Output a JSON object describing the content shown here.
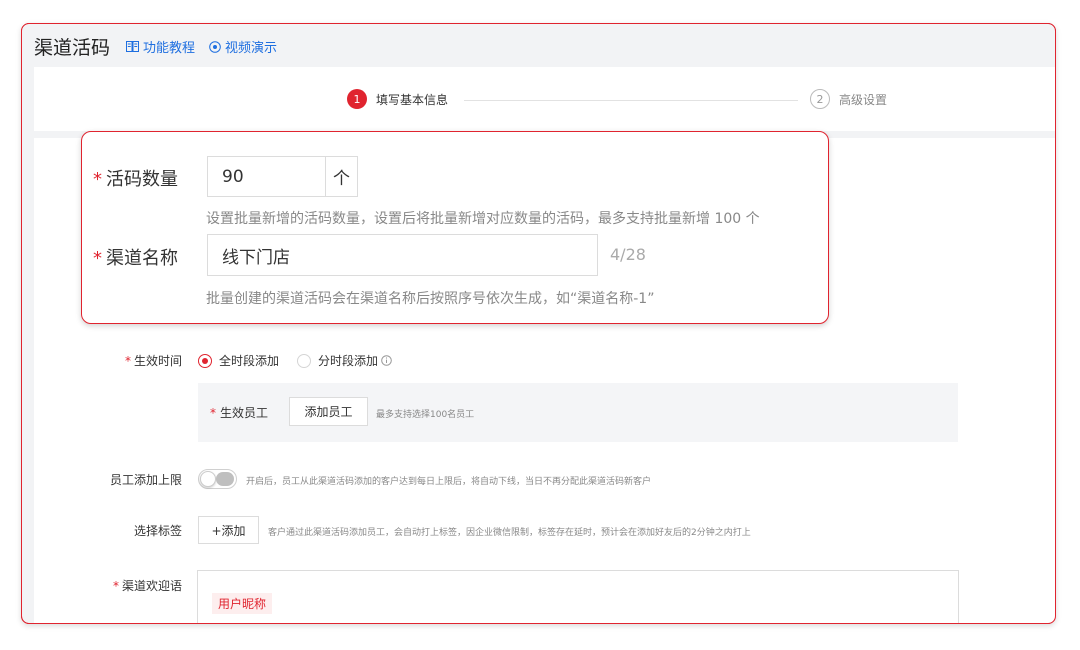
{
  "header": {
    "title": "渠道活码",
    "tutorial_label": "功能教程",
    "video_label": "视频演示"
  },
  "steps": [
    {
      "num": "1",
      "label": "填写基本信息",
      "active": true
    },
    {
      "num": "2",
      "label": "高级设置",
      "active": false
    }
  ],
  "quantity": {
    "label": "活码数量",
    "value": "90",
    "unit": "个",
    "hint": "设置批量新增的活码数量，设置后将批量新增对应数量的活码，最多支持批量新增 100 个"
  },
  "channel_name": {
    "label": "渠道名称",
    "value": "线下门店",
    "count": "4/28",
    "hint": "批量创建的渠道活码会在渠道名称后按照序号依次生成，如“渠道名称-1”"
  },
  "effective_time": {
    "label": "生效时间",
    "option_all": "全时段添加",
    "option_partial": "分时段添加",
    "selected": "全时段添加"
  },
  "staff": {
    "label": "生效员工",
    "add_button": "添加员工",
    "hint": "最多支持选择100名员工"
  },
  "limit": {
    "label": "员工添加上限",
    "enabled": false,
    "hint": "开启后，员工从此渠道活码添加的客户达到每日上限后，将自动下线，当日不再分配此渠道活码新客户"
  },
  "tags": {
    "label": "选择标签",
    "add_button": "+添加",
    "hint": "客户通过此渠道活码添加员工，会自动打上标签，因企业微信限制，标签存在延时，预计会在添加好友后的2分钟之内打上"
  },
  "welcome": {
    "label": "渠道欢迎语",
    "chip": "用户昵称"
  },
  "colors": {
    "accent": "#e0242f",
    "link": "#1f6fe0"
  }
}
